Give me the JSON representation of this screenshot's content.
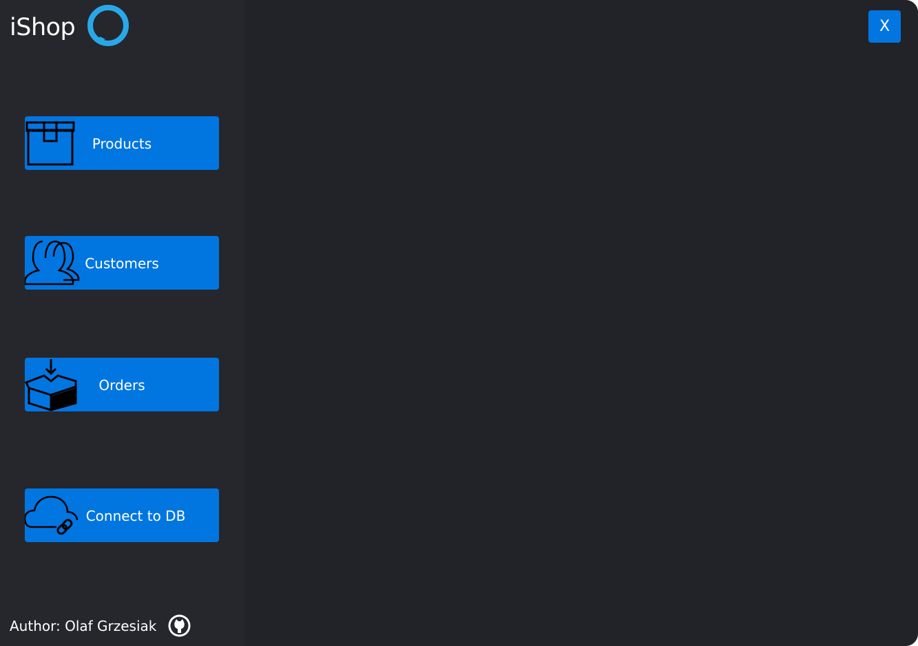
{
  "app": {
    "title": "iShop",
    "accent_color": "#0276e0",
    "sidebar_bg": "#25272d",
    "main_bg": "#212329"
  },
  "window": {
    "close_label": "X"
  },
  "sidebar": {
    "items": [
      {
        "label": "Products",
        "icon": "box-icon"
      },
      {
        "label": "Customers",
        "icon": "users-icon"
      },
      {
        "label": "Orders",
        "icon": "open-box-download-icon"
      },
      {
        "label": "Connect to DB",
        "icon": "cloud-link-icon"
      }
    ],
    "author": "Author: Olaf Grzesiak",
    "author_link_icon": "github-icon"
  }
}
